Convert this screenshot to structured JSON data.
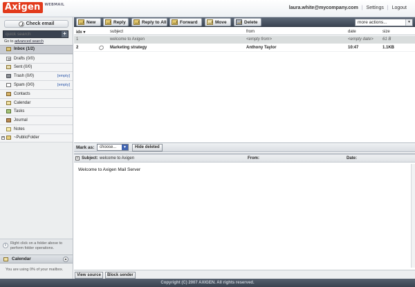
{
  "header": {
    "logo_text": "Axigen",
    "logo_sub": "WEBMAIL",
    "user_email": "laura.white@mycompany.com",
    "settings_label": "Settings",
    "logout_label": "Logout"
  },
  "sidebar": {
    "check_email_label": "Check email",
    "search_placeholder": "quick search",
    "search_go": "+",
    "advanced_prefix": "Go to ",
    "advanced_link": "advanced search",
    "folders": [
      {
        "label": "Inbox (1/2)",
        "icon": "inbox-icon",
        "selected": true
      },
      {
        "label": "Drafts (0/0)",
        "icon": "drafts-icon"
      },
      {
        "label": "Sent (0/0)",
        "icon": "sent-icon"
      },
      {
        "label": "Trash (0/0)",
        "icon": "trash-icon",
        "empty": "[empty]"
      },
      {
        "label": "Spam (0/0)",
        "icon": "spam-icon",
        "empty": "[empty]"
      },
      {
        "label": "Contacts",
        "icon": "contacts-icon"
      },
      {
        "label": "Calendar",
        "icon": "calendar-icon"
      },
      {
        "label": "Tasks",
        "icon": "tasks-icon"
      },
      {
        "label": "Journal",
        "icon": "journal-icon"
      },
      {
        "label": "Notes",
        "icon": "notes-icon"
      },
      {
        "label": "~PublicFolder",
        "icon": "public-folder-icon",
        "expander": "+"
      }
    ],
    "hint_text": "Right click on a folder above to perform folder operations.",
    "calendar_label": "Calendar",
    "collapse_glyph": "▲",
    "usage_text": "You are using 0% of your mailbox."
  },
  "toolbar": {
    "new_label": "New",
    "reply_label": "Reply",
    "reply_all_label": "Reply to All",
    "forward_label": "Forward",
    "move_label": "Move",
    "delete_label": "Delete",
    "more_actions": "more actions..."
  },
  "message_list": {
    "columns": {
      "idx": "idx ▾",
      "subject": "subject",
      "from": "from",
      "date": "date",
      "size": "size"
    },
    "rows": [
      {
        "idx": "1",
        "subject": "welcome to Axigen",
        "from": "<empty from>",
        "date": "<empty date>",
        "size": "61 B",
        "read": true
      },
      {
        "idx": "2",
        "subject": "Marketing strategy",
        "from": "Anthony Taylor",
        "date": "10:47",
        "size": "1.1KB",
        "read": false,
        "attachment": true
      }
    ]
  },
  "mark_bar": {
    "label": "Mark as:",
    "select_value": "choose...",
    "hide_deleted_label": "Hide deleted"
  },
  "preview": {
    "expander": "+",
    "subject_label": "Subject:",
    "subject_value": "welcome to Axigen",
    "from_label": "From:",
    "date_label": "Date:",
    "body": "Welcome to Axigen Mail Server",
    "view_source_label": "View source",
    "block_sender_label": "Block sender"
  },
  "footer": {
    "copyright": "Copyright (C) 2007 AXIGEN. All rights reserved."
  },
  "colors": {
    "toolbar_bg": "#4a5462",
    "logo_red": "#e23a1b",
    "selected_row": "#d9dddd"
  }
}
